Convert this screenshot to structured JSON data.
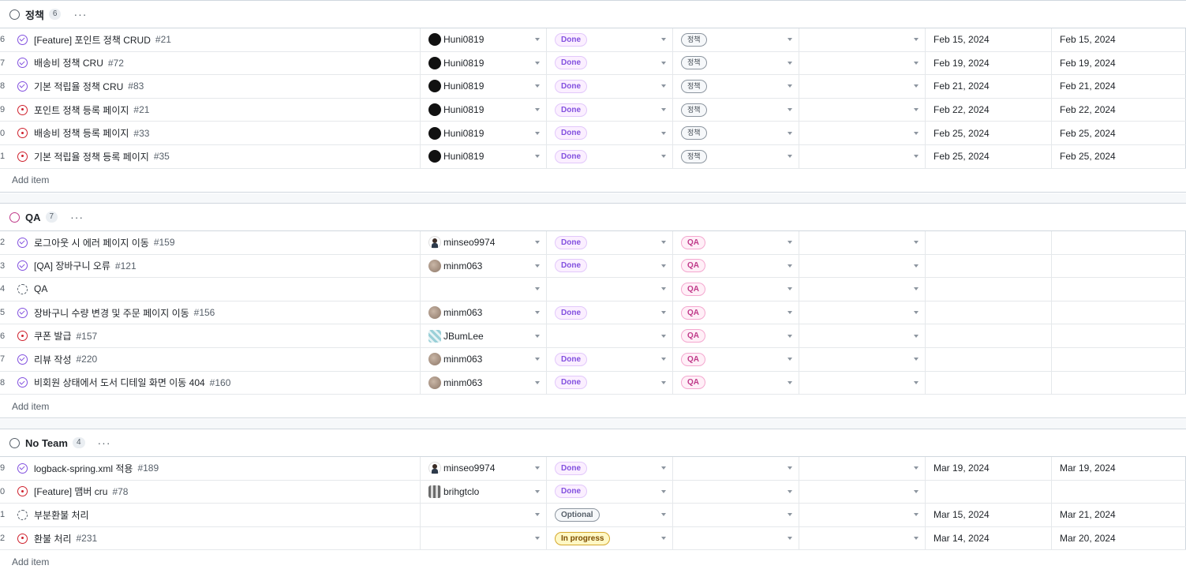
{
  "groups": [
    {
      "name": "정책",
      "count": "6",
      "menu": "···",
      "add_label": "Add item",
      "rows": [
        {
          "num": "6",
          "state": "done",
          "title": "[Feature] 포인트 정책 CRUD",
          "issue": "#21",
          "assignee": "Huni0819",
          "avatar": "dark",
          "status": "Done",
          "team": "정책",
          "start": "Feb 15, 2024",
          "end": "Feb 15, 2024"
        },
        {
          "num": "7",
          "state": "done",
          "title": "배송비 정책 CRU",
          "issue": "#72",
          "assignee": "Huni0819",
          "avatar": "dark",
          "status": "Done",
          "team": "정책",
          "start": "Feb 19, 2024",
          "end": "Feb 19, 2024"
        },
        {
          "num": "8",
          "state": "done",
          "title": "기본 적립율 정책 CRU",
          "issue": "#83",
          "assignee": "Huni0819",
          "avatar": "dark",
          "status": "Done",
          "team": "정책",
          "start": "Feb 21, 2024",
          "end": "Feb 21, 2024"
        },
        {
          "num": "9",
          "state": "open",
          "title": "포인트 정책 등록 페이지",
          "issue": "#21",
          "assignee": "Huni0819",
          "avatar": "dark",
          "status": "Done",
          "team": "정책",
          "start": "Feb 22, 2024",
          "end": "Feb 22, 2024"
        },
        {
          "num": "0",
          "state": "open",
          "title": "배송비 정책 등록 페이지",
          "issue": "#33",
          "assignee": "Huni0819",
          "avatar": "dark",
          "status": "Done",
          "team": "정책",
          "start": "Feb 25, 2024",
          "end": "Feb 25, 2024"
        },
        {
          "num": "1",
          "state": "open",
          "title": "기본 적립율 정책 등록 페이지",
          "issue": "#35",
          "assignee": "Huni0819",
          "avatar": "dark",
          "status": "Done",
          "team": "정책",
          "start": "Feb 25, 2024",
          "end": "Feb 25, 2024"
        }
      ]
    },
    {
      "name": "QA",
      "count": "7",
      "menu": "···",
      "add_label": "Add item",
      "rows": [
        {
          "num": "2",
          "state": "done",
          "title": "로그아웃 시 에러 페이지 이동",
          "issue": "#159",
          "assignee": "minseo9974",
          "avatar": "person",
          "status": "Done",
          "team": "QA",
          "start": "",
          "end": ""
        },
        {
          "num": "3",
          "state": "done",
          "title": "[QA] 장바구니 오류",
          "issue": "#121",
          "assignee": "minm063",
          "avatar": "photo",
          "status": "Done",
          "team": "QA",
          "start": "",
          "end": ""
        },
        {
          "num": "4",
          "state": "draft",
          "title": "QA",
          "issue": "",
          "assignee": "",
          "avatar": "",
          "status": "",
          "team": "QA",
          "start": "",
          "end": ""
        },
        {
          "num": "5",
          "state": "done",
          "title": "장바구니 수량 변경 및 주문 페이지 이동",
          "issue": "#156",
          "assignee": "minm063",
          "avatar": "photo",
          "status": "Done",
          "team": "QA",
          "start": "",
          "end": ""
        },
        {
          "num": "6",
          "state": "open",
          "title": "쿠폰 발급",
          "issue": "#157",
          "assignee": "JBumLee",
          "avatar": "pattern",
          "status": "",
          "team": "QA",
          "start": "",
          "end": ""
        },
        {
          "num": "7",
          "state": "done",
          "title": "리뷰 작성",
          "issue": "#220",
          "assignee": "minm063",
          "avatar": "photo",
          "status": "Done",
          "team": "QA",
          "start": "",
          "end": ""
        },
        {
          "num": "8",
          "state": "done",
          "title": "비회원 상태에서 도서 디테일 화면 이동 404",
          "issue": "#160",
          "assignee": "minm063",
          "avatar": "photo",
          "status": "Done",
          "team": "QA",
          "start": "",
          "end": ""
        }
      ]
    },
    {
      "name": "No Team",
      "count": "4",
      "menu": "···",
      "add_label": "Add item",
      "rows": [
        {
          "num": "9",
          "state": "done",
          "title": "logback-spring.xml 적용",
          "issue": "#189",
          "assignee": "minseo9974",
          "avatar": "person",
          "status": "Done",
          "team": "",
          "start": "Mar 19, 2024",
          "end": "Mar 19, 2024"
        },
        {
          "num": "0",
          "state": "open",
          "title": "[Feature] 맴버 cru",
          "issue": "#78",
          "assignee": "brihgtclo",
          "avatar": "pixel",
          "status": "Done",
          "team": "",
          "start": "",
          "end": ""
        },
        {
          "num": "1",
          "state": "draft",
          "title": "부분환불 처리",
          "issue": "",
          "assignee": "",
          "avatar": "",
          "status": "Optional",
          "team": "",
          "start": "Mar 15, 2024",
          "end": "Mar 21, 2024"
        },
        {
          "num": "2",
          "state": "open",
          "title": "환불 처리",
          "issue": "#231",
          "assignee": "",
          "avatar": "",
          "status": "In progress",
          "team": "",
          "start": "Mar 14, 2024",
          "end": "Mar 20, 2024"
        }
      ]
    }
  ],
  "colors": {
    "done": "#8250df",
    "open": "#cf222e",
    "qa": "#bf3989",
    "progress": "#d4a72c"
  }
}
